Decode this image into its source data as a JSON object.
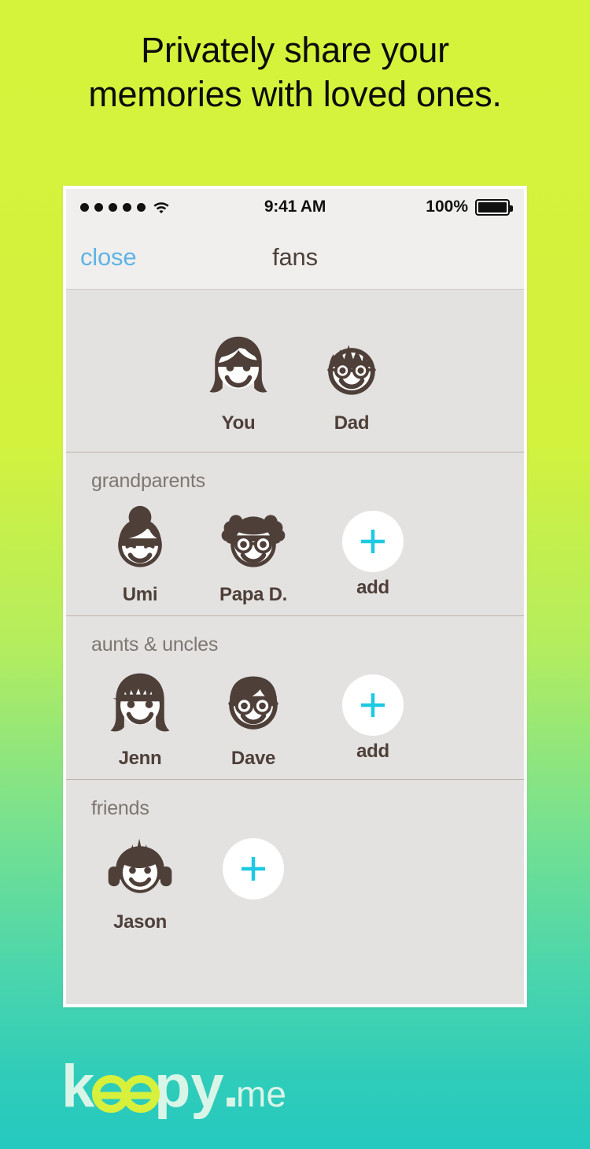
{
  "headline": {
    "line1": "Privately share your",
    "line2": "memories with loved ones."
  },
  "colors": {
    "bg_top": "#d6f33c",
    "bg_bottom": "#25c9bf",
    "accent_cyan": "#1ec9e2",
    "avatar_brown": "#4e3f39",
    "link_blue": "#5fb4e5",
    "screen_bg": "#e3e2e0",
    "navbar_bg": "#f0efed",
    "logo_lime": "#d6f03c",
    "logo_mint": "#d9f5e8"
  },
  "statusbar": {
    "signal_dots": 5,
    "wifi_icon": "wifi-icon",
    "time": "9:41 AM",
    "battery_percent": "100%",
    "battery_icon": "battery-full-icon"
  },
  "navbar": {
    "close_label": "close",
    "title": "fans"
  },
  "sections": [
    {
      "id": "parents",
      "label": "",
      "show_label": false,
      "people": [
        {
          "name": "You",
          "avatar": "girl-long-hair-avatar"
        },
        {
          "name": "Dad",
          "avatar": "man-spiky-hair-glasses-avatar"
        }
      ],
      "add": null
    },
    {
      "id": "grandparents",
      "label": "grandparents",
      "show_label": true,
      "people": [
        {
          "name": "Umi",
          "avatar": "grandma-bun-avatar"
        },
        {
          "name": "Papa D.",
          "avatar": "grandpa-glasses-avatar"
        }
      ],
      "add": {
        "label": "add",
        "icon": "plus-icon"
      }
    },
    {
      "id": "aunts-uncles",
      "label": "aunts & uncles",
      "show_label": true,
      "people": [
        {
          "name": "Jenn",
          "avatar": "woman-bob-hair-avatar"
        },
        {
          "name": "Dave",
          "avatar": "man-glasses-avatar"
        }
      ],
      "add": {
        "label": "add",
        "icon": "plus-icon"
      }
    },
    {
      "id": "friends",
      "label": "friends",
      "show_label": true,
      "people": [
        {
          "name": "Jason",
          "avatar": "boy-headphones-avatar"
        }
      ],
      "add": {
        "label": "",
        "icon": "plus-icon"
      }
    }
  ],
  "logo": {
    "text": "keepy.me",
    "part_mint_1": "k",
    "part_lime": "ee",
    "part_mint_2": "py",
    "suffix": ".me"
  }
}
